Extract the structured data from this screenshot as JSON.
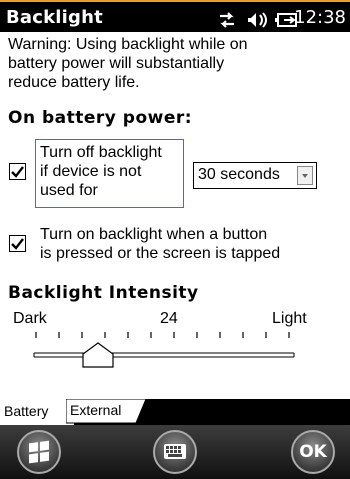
{
  "window": {
    "title": "Backlight",
    "time": "12:38"
  },
  "status_icons": [
    "sync-icon",
    "volume-icon",
    "battery-charging-icon"
  ],
  "warning": {
    "line1": "Warning: Using backlight while on",
    "line2": "battery power will substantially",
    "line3": "reduce battery life."
  },
  "battery_section": {
    "heading": "On battery power:",
    "turn_off": {
      "checked": true,
      "line1": "Turn off backlight",
      "line2": "if device is not",
      "line3": "used for",
      "timeout_value": "30 seconds"
    },
    "turn_on": {
      "checked": true,
      "line1": "Turn on backlight when a button",
      "line2": "is pressed or the screen is tapped"
    }
  },
  "intensity": {
    "heading": "Backlight Intensity",
    "min_label": "Dark",
    "value": "24",
    "max_label": "Light"
  },
  "tabs": [
    {
      "label": "Battery",
      "active": true
    },
    {
      "label": "External",
      "active": false
    }
  ],
  "softkeys": [
    "start-icon",
    "keyboard-icon",
    "OK"
  ],
  "colors": {
    "accent": "#e8a12c",
    "focus": "#3a6fd8"
  }
}
